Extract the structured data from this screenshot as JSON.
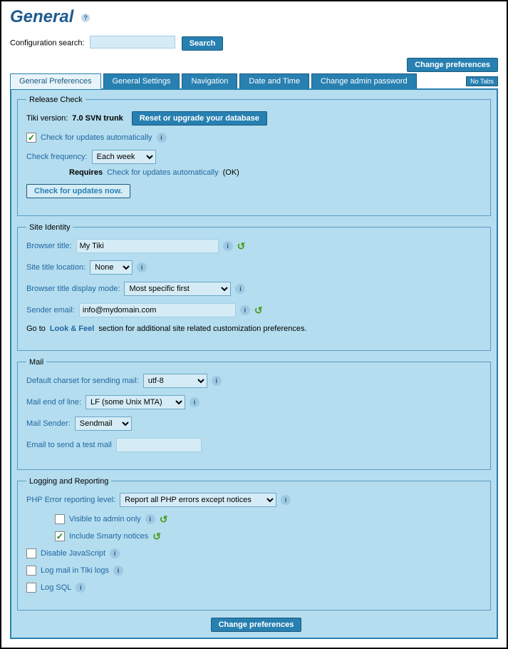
{
  "page": {
    "title": "General"
  },
  "search": {
    "label": "Configuration search:",
    "placeholder": "",
    "button": "Search"
  },
  "topButtons": {
    "changePrefs": "Change preferences",
    "noTabs": "No Tabs"
  },
  "tabs": [
    "General Preferences",
    "General Settings",
    "Navigation",
    "Date and Time",
    "Change admin password"
  ],
  "releaseCheck": {
    "legend": "Release Check",
    "versionLabel": "Tiki version:",
    "version": "7.0 SVN trunk",
    "resetBtn": "Reset or upgrade your database",
    "autoCheck": "Check for updates automatically",
    "freqLabel": "Check frequency:",
    "freqValue": "Each week",
    "requiresLabel": "Requires",
    "requiresLink": "Check for updates automatically",
    "requiresSuffix": "(OK)",
    "checkNowBtn": "Check for updates now."
  },
  "siteIdentity": {
    "legend": "Site Identity",
    "browserTitleLabel": "Browser title:",
    "browserTitle": "My Tiki",
    "titleLocLabel": "Site title location:",
    "titleLocValue": "None",
    "displayModeLabel": "Browser title display mode:",
    "displayModeValue": "Most specific first",
    "senderEmailLabel": "Sender email:",
    "senderEmail": "info@mydomain.com",
    "gotoPrefix": "Go to",
    "gotoLink": "Look & Feel",
    "gotoSuffix": "section for additional site related customization preferences."
  },
  "mail": {
    "legend": "Mail",
    "charsetLabel": "Default charset for sending mail:",
    "charsetValue": "utf-8",
    "eolLabel": "Mail end of line:",
    "eolValue": "LF (some Unix MTA)",
    "senderLabel": "Mail Sender:",
    "senderValue": "Sendmail",
    "testLabel": "Email to send a test mail",
    "testValue": ""
  },
  "logging": {
    "legend": "Logging and Reporting",
    "phpLabel": "PHP Error reporting level:",
    "phpValue": "Report all PHP errors except notices",
    "visibleAdmin": "Visible to admin only",
    "smartyNotices": "Include Smarty notices",
    "disableJs": "Disable JavaScript",
    "logMail": "Log mail in Tiki logs",
    "logSql": "Log SQL"
  },
  "bottom": {
    "changePrefs": "Change preferences"
  }
}
